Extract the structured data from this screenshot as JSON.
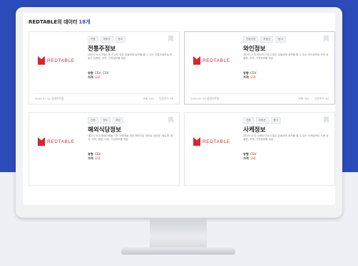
{
  "header": {
    "title": "REDTABLE의 데이터",
    "count": "18개"
  },
  "colors": {
    "brand_red": "#d7262f",
    "accent_blue": "#2a4bb8"
  },
  "cards": [
    {
      "logo_text": "REDTABLE",
      "tags": [
        "관광",
        "부동산",
        "음식"
      ],
      "title": "전통주정보",
      "desc": "데이터 소개 전통주에 관심이 많은 분들에게 정보를 줄 수 있는 전통주정보로 전통주 상품명, 지역, 가격정보를 제공",
      "type_label": "유형",
      "type_value": "CSV, CSV",
      "price_label": "가격",
      "price_value": "무료",
      "date": "2020.07.16 업데이트됨",
      "views": "조회 250",
      "downloads": "다운로드 56"
    },
    {
      "logo_text": "REDTABLE",
      "tags": [
        "관광산업",
        "부동산",
        "음식"
      ],
      "title": "와인정보",
      "desc": "데이터 소개 와인에 관심이 많은 분들에게 정보를 줄 수 있는 와인정보로 와인 상품명, 지역, 가격정보를 제공",
      "type_label": "유형",
      "type_value": "CSV",
      "price_label": "가격",
      "price_value": "무료",
      "date": "2020.07.16 업데이트됨",
      "views": "조회 302",
      "downloads": "다운로드 40"
    },
    {
      "logo_text": "REDTABLE",
      "tags": [
        "관광",
        "한소",
        "부당"
      ],
      "title": "해외식당정보",
      "desc": "데이터 소개 해외여행을 가는 여행객을 위한 해외식당 정보로 상호명, 메뉴명, 음식, 지역, 평점, 리뷰, 식당정보를 제공",
      "type_label": "유형",
      "type_value": "CSV",
      "price_label": "가격",
      "price_value": "무료",
      "date": "",
      "views": "",
      "downloads": ""
    },
    {
      "logo_text": "REDTABLE",
      "tags": [
        "관광",
        "부동산",
        "음식"
      ],
      "title": "사케정보",
      "desc": "데이터 소개 사케에 관심이 많은 분들에게 정보를 줄 수 있는 사케정보로 사케 상품명, 지역, 가격정보를 제공",
      "type_label": "유형",
      "type_value": "CSV",
      "price_label": "가격",
      "price_value": "무료",
      "date": "",
      "views": "",
      "downloads": ""
    }
  ]
}
